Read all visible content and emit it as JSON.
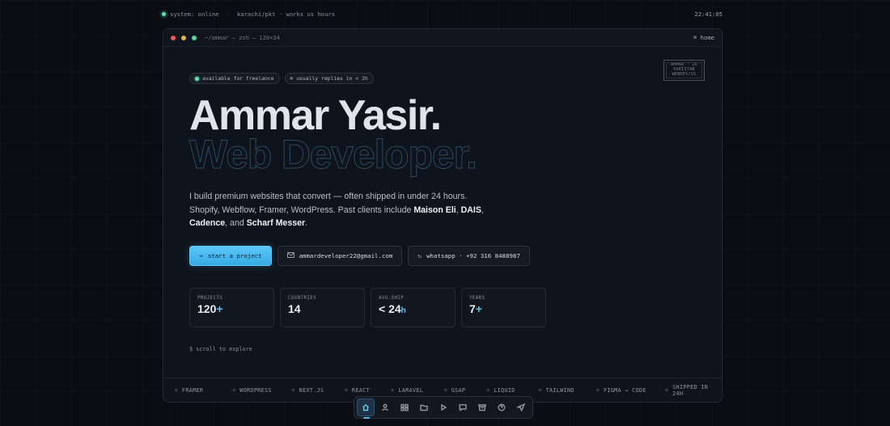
{
  "status_bar": {
    "status": "system: online",
    "location": "karachi/pkt · works us hours",
    "clock": "22:41:05"
  },
  "window": {
    "title": "~/ammar — zsh — 120×34",
    "home_label": "⌘ home",
    "stamp": [
      "AMMAR · 26",
      "PAKISTAN",
      "WEBDEV/OS"
    ]
  },
  "hero": {
    "chips": [
      "available for freelance",
      "⌘ usually replies in < 2h"
    ],
    "name": "Ammar Yasir.",
    "role": "Web Developer.",
    "bio_intro": "I build premium websites that convert — often shipped in under 24 hours. Shopify, Webflow, Framer, WordPress. Past clients include ",
    "clients": [
      "Maison Eli",
      "DAIS",
      "Cadence",
      "Scharf Messer"
    ],
    "bio_end": "."
  },
  "ctas": {
    "primary": "start a project",
    "email": "ammardeveloper22@gmail.com",
    "whatsapp": "whatsapp · +92 316 8488987"
  },
  "stats": [
    {
      "label": "PROJECTS",
      "value": "120",
      "suffix": "+"
    },
    {
      "label": "COUNTRIES",
      "value": "14",
      "suffix": ""
    },
    {
      "label": "AVG.SHIP",
      "value": "< 24",
      "suffix": "h"
    },
    {
      "label": "YEARS",
      "value": "7",
      "suffix": "+"
    }
  ],
  "scroll_hint": "$ scroll to explore",
  "ticker": [
    "FRAMER",
    "WORDPRESS",
    "NEXT.JS",
    "REACT",
    "LARAVEL",
    "GSAP",
    "LIQUID",
    "TAILWIND",
    "FIGMA → CODE",
    "SHIPPED IN 24H"
  ],
  "dock": [
    {
      "icon": "home-icon",
      "active": true
    },
    {
      "icon": "user-icon",
      "active": false
    },
    {
      "icon": "grid-icon",
      "active": false
    },
    {
      "icon": "folder-icon",
      "active": false
    },
    {
      "icon": "play-icon",
      "active": false
    },
    {
      "icon": "chat-icon",
      "active": false
    },
    {
      "icon": "archive-icon",
      "active": false
    },
    {
      "icon": "help-icon",
      "active": false
    },
    {
      "icon": "send-icon",
      "active": false
    }
  ],
  "colors": {
    "accent": "#4fb6ea",
    "online": "#5ee0b0",
    "background": "#0a0d13"
  }
}
